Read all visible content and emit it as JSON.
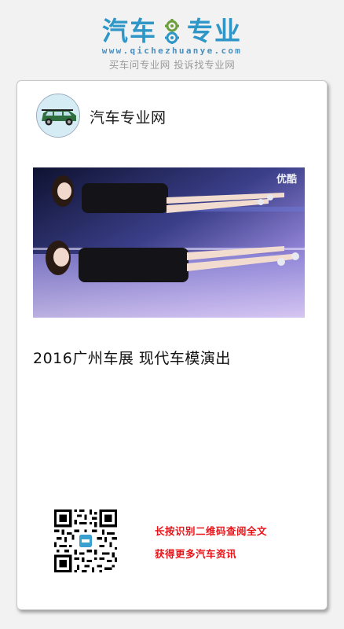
{
  "brand": {
    "logo_left": "汽车",
    "logo_right": "专业",
    "domain": "www.qichezhuanye.com",
    "slogan": "买车问专业网 投诉找专业网",
    "color": "#2e97c8"
  },
  "account": {
    "name": "汽车专业网",
    "avatar_icon": "car-avatar-icon"
  },
  "video": {
    "watermark": "优酷"
  },
  "article": {
    "title": "2016广州车展  现代车模演出"
  },
  "footer": {
    "qr_icon": "qr-code-icon",
    "hint_line1": "长按识别二维码查阅全文",
    "hint_line2": "获得更多汽车资讯",
    "hint_color": "#e8141a"
  }
}
